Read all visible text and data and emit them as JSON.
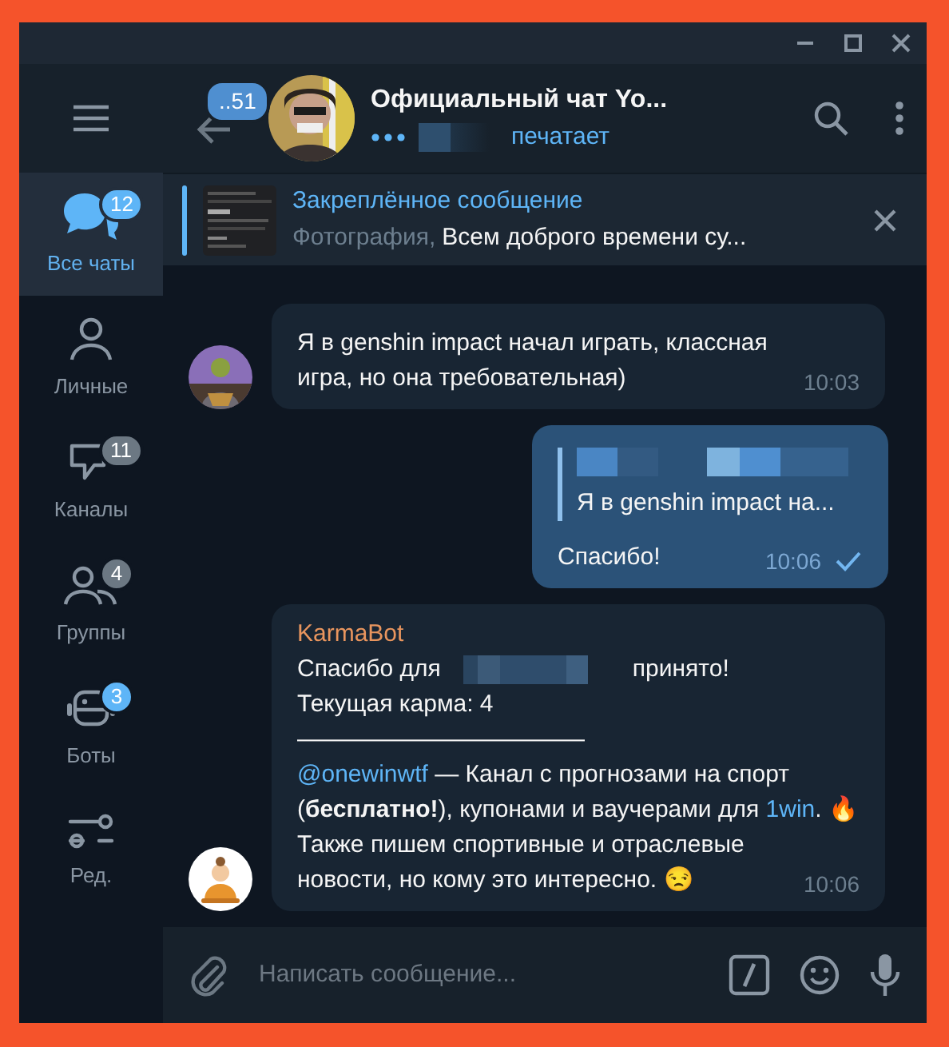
{
  "sidebar": {
    "items": [
      {
        "kind": "chats",
        "label": "Все чаты",
        "badge": "12",
        "muted": false,
        "selected": true
      },
      {
        "kind": "person",
        "label": "Личные",
        "selected": false
      },
      {
        "kind": "channel",
        "label": "Каналы",
        "badge": "11",
        "muted": true,
        "selected": false
      },
      {
        "kind": "group",
        "label": "Группы",
        "badge": "4",
        "muted": true,
        "selected": false
      },
      {
        "kind": "bot",
        "label": "Боты",
        "badge": "3",
        "muted": false,
        "selected": false
      },
      {
        "kind": "edit",
        "label": "Ред.",
        "selected": false
      }
    ]
  },
  "header": {
    "back_badge": "..51",
    "title": "Официальный чат Yo...",
    "status": "печатает"
  },
  "pinned": {
    "label": "Закреплённое сообщение",
    "media": "Фотография,",
    "text": "Всем доброго времени су..."
  },
  "messages": [
    {
      "kind": "incoming",
      "paragraphs": [
        [
          {
            "kind": "text",
            "text": "Я в genshin impact начал играть, классная игра, но она требовательная)"
          }
        ]
      ],
      "time": "10:03"
    },
    {
      "kind": "outgoing",
      "reply_text": "Я в genshin impact на...",
      "paragraphs": [
        [
          {
            "kind": "text",
            "text": "Спасибо!"
          }
        ]
      ],
      "time": "10:06",
      "read": false
    },
    {
      "kind": "incoming",
      "sender": "KarmaBot",
      "paragraphs": [
        [
          {
            "kind": "text",
            "text": "Спасибо для"
          },
          {
            "kind": "redacted"
          },
          {
            "kind": "text",
            "text": "принято!"
          }
        ],
        [
          {
            "kind": "text",
            "text": "Текущая карма: 4"
          }
        ],
        [
          {
            "kind": "text",
            "text": "————————————"
          }
        ],
        [
          {
            "kind": "link",
            "text": "@onewinwtf"
          },
          {
            "kind": "text",
            "text": " — Канал с прогнозами на спорт (**бесплатно!**), купонами и ваучерами для "
          },
          {
            "kind": "link",
            "text": "1win"
          },
          {
            "kind": "text",
            "text": ". 🔥"
          }
        ],
        [
          {
            "kind": "text",
            "text": "Также пишем спортивные и отраслевые новости, но кому это интересно. 😒"
          }
        ]
      ],
      "time": "10:06"
    }
  ],
  "composer": {
    "placeholder": "Написать сообщение..."
  }
}
